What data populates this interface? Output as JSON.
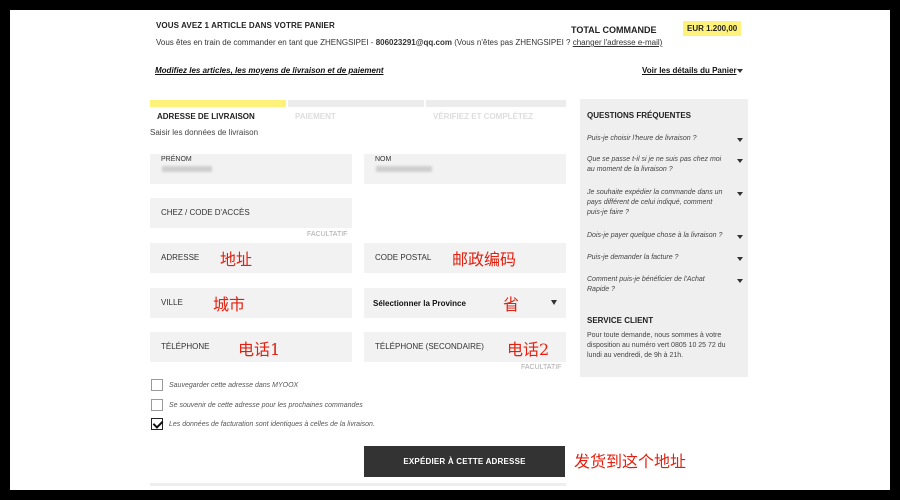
{
  "header": {
    "title": "VOUS AVEZ 1 ARTICLE DANS VOTRE PANIER",
    "subtitle_prefix": "Vous êtes en train de commander en tant que ZHENGSIPEI -",
    "email": "806023291@qq.com",
    "subtitle_middle": "Vous n'êtes pas ZHENGSIPEI ?",
    "change_email_link": "changer l'adresse e-mail)",
    "open_paren": "(",
    "total_label": "TOTAL COMMANDE",
    "total_value": "EUR 1.200,00",
    "modify_link": "Modifiez les articles, les moyens de livraison et de paiement",
    "details_link": "Voir les détails du Panier"
  },
  "steps": [
    {
      "label": "ADRESSE DE LIVRAISON",
      "active": true
    },
    {
      "label": "PAIEMENT",
      "active": false
    },
    {
      "label": "VÉRIFIEZ ET COMPLÉTEZ",
      "active": false
    }
  ],
  "step_description": "Saisir les données de livraison",
  "form": {
    "first_name_label": "PRÉNOM",
    "last_name_label": "NOM",
    "company_label": "CHEZ / CODE D'ACCÈS",
    "optional_label": "FACULTATIF",
    "address_label": "ADRESSE",
    "postal_label": "CODE POSTAL",
    "city_label": "VILLE",
    "province_select": "Sélectionner la Province",
    "phone_label": "TÉLÉPHONE",
    "phone2_label": "TÉLÉPHONE (SECONDAIRE)",
    "optional_label2": "FACULTATIF"
  },
  "annotations": {
    "address": "地址",
    "postal": "邮政编码",
    "city": "城市",
    "province": "省",
    "phone1": "电话1",
    "phone2": "电话2",
    "submit": "发货到这个地址"
  },
  "checkboxes": [
    {
      "label": "Sauvegarder cette adresse dans MYOOX",
      "checked": false
    },
    {
      "label": "Se souvenir de cette adresse pour les prochaines commandes",
      "checked": false
    },
    {
      "label": "Les données de facturation sont identiques à celles de la livraison.",
      "checked": true
    }
  ],
  "submit_button": "EXPÉDIER À CETTE ADRESSE",
  "faq": {
    "title": "QUESTIONS FRÉQUENTES",
    "items": [
      "Puis-je choisir l'heure de livraison ?",
      "Que se passe t-il si je ne suis pas chez moi au moment de la livraison ?",
      "Je souhaite expédier la commande dans un pays différent de celui indiqué, comment puis-je faire ?",
      "Dois-je payer quelque chose à la livraison ?",
      "Puis-je demander la facture ?",
      "Comment puis-je bénéficier de l'Achat Rapide ?"
    ],
    "service_title": "SERVICE CLIENT",
    "service_text": "Pour toute demande, nous sommes à votre disposition au numéro vert 0805 10 25 72 du lundi au vendredi, de 9h à 21h."
  },
  "colors": {
    "accent_yellow": "#fff27a",
    "annotation_red": "#e3200f",
    "button_dark": "#333333",
    "panel_gray": "#efefef"
  }
}
